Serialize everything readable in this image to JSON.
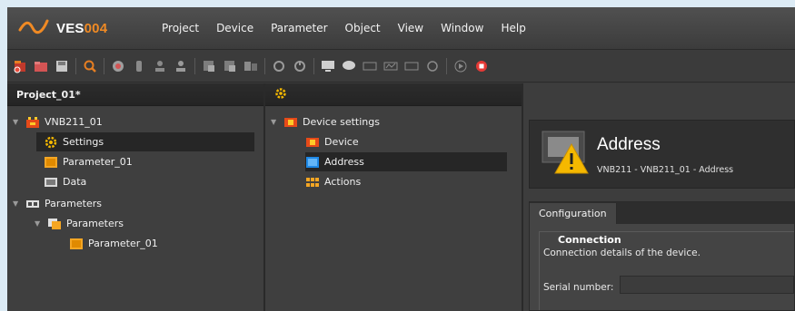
{
  "app": {
    "logo_text_a": "VES",
    "logo_text_b": "004"
  },
  "menu": [
    "Project",
    "Device",
    "Parameter",
    "Object",
    "View",
    "Window",
    "Help"
  ],
  "toolbar": {
    "icons": [
      "new-project-icon",
      "open-icon",
      "save-icon",
      "search-icon",
      "connect-icon",
      "disconnect-icon",
      "upload-icon",
      "download-icon",
      "export-icon",
      "import-icon",
      "compare-icon",
      "refresh-icon",
      "reset-icon",
      "monitor-icon",
      "chat-icon",
      "io-icon",
      "signal-icon",
      "io2-icon",
      "record-icon",
      "play-icon",
      "stop-icon"
    ]
  },
  "project_panel": {
    "title": "Project_01*",
    "tree": {
      "device": "VNB211_01",
      "settings": "Settings",
      "parameter": "Parameter_01",
      "data": "Data",
      "parameters_root": "Parameters",
      "parameters_folder": "Parameters",
      "parameters_item": "Parameter_01"
    }
  },
  "settings_panel": {
    "tree": {
      "root": "Device settings",
      "device": "Device",
      "address": "Address",
      "actions": "Actions"
    }
  },
  "detail": {
    "title": "Address",
    "subtitle": "VNB211 - VNB211_01 - Address",
    "tab": "Configuration",
    "group_title": "Connection",
    "group_desc": "Connection details of the device.",
    "serial_label": "Serial number:",
    "serial_value": ""
  },
  "colors": {
    "accent_orange": "#f08a24",
    "selection": "#262626",
    "background": "#3a3a3a"
  }
}
